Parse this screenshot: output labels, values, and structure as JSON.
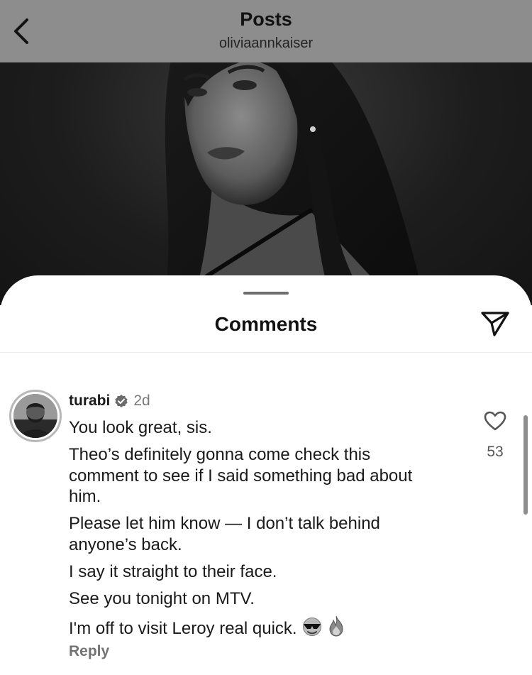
{
  "header": {
    "title": "Posts",
    "username": "oliviaannkaiser"
  },
  "comments_sheet": {
    "title": "Comments",
    "comment": {
      "username": "turabi",
      "verified": true,
      "time": "2d",
      "lines": [
        "You look great, sis.",
        "Theo’s definitely gonna come check this comment to see if I said something bad about him.",
        "Please let him know — I don’t talk behind anyone’s back.",
        "I say it straight to their face.",
        "See you tonight on MTV.",
        "I'm off to visit Leroy real quick."
      ],
      "emojis": [
        "sunglasses-emoji",
        "fire-emoji"
      ],
      "likes": "53",
      "reply_label": "Reply"
    }
  },
  "icons": {
    "back": "chevron-left-icon",
    "share": "paper-plane-icon",
    "like": "heart-icon",
    "verified": "verified-badge-icon"
  },
  "colors": {
    "topbar_bg": "#8d8d8d",
    "muted_text": "#737373",
    "text": "#1a1a1a"
  }
}
